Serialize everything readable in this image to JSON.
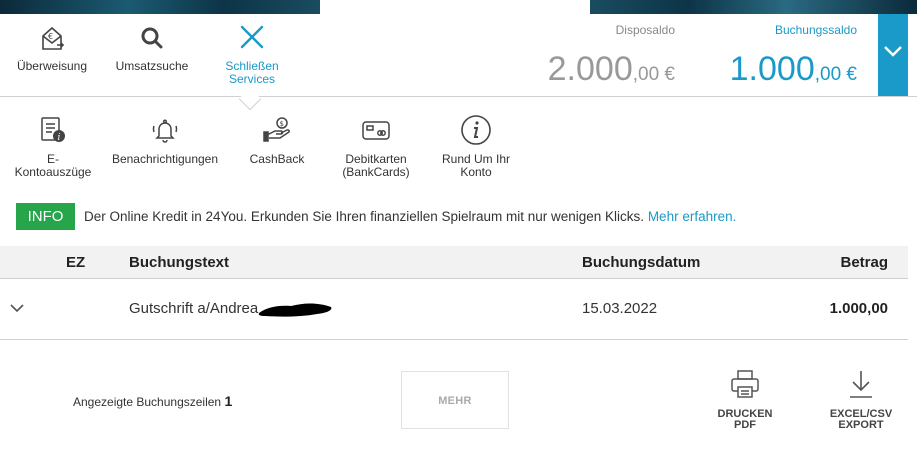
{
  "actions": {
    "ueberweisung": {
      "label": "Überweisung",
      "icon": "transfer-envelope-icon"
    },
    "umsatzsuche": {
      "label": "Umsatzsuche",
      "icon": "search-icon"
    },
    "close_services": {
      "label": "Schließen\nServices",
      "icon": "close-icon"
    }
  },
  "balances": {
    "dispo": {
      "title": "Disposaldo",
      "int": "2.000",
      "dec": ",00 €"
    },
    "buchung": {
      "title": "Buchungssaldo",
      "int": "1.000",
      "dec": ",00 €"
    }
  },
  "services": [
    {
      "label": "E-\nKontoauszüge",
      "icon": "statement-info-icon"
    },
    {
      "label": "Benachrichtigungen",
      "icon": "bell-icon"
    },
    {
      "label": "CashBack",
      "icon": "cashback-hand-coin-icon"
    },
    {
      "label": "Debitkarten\n(BankCards)",
      "icon": "card-icon"
    },
    {
      "label": "Rund Um Ihr\nKonto",
      "icon": "info-circle-icon"
    }
  ],
  "info": {
    "badge": "INFO",
    "text": "Der Online Kredit in 24You. Erkunden Sie Ihren finanziellen Spielraum mit nur wenigen Klicks. ",
    "link": "Mehr erfahren."
  },
  "table": {
    "headers": {
      "ez": "EZ",
      "text": "Buchungstext",
      "date": "Buchungsdatum",
      "amount": "Betrag"
    },
    "rows": [
      {
        "text": "Gutschrift a/Andrea",
        "date": "15.03.2022",
        "amount": "1.000,00"
      }
    ]
  },
  "footer": {
    "count_label": "Angezeigte Buchungszeilen",
    "count_value": "1",
    "more_label": "MEHR",
    "print_label": "DRUCKEN\nPDF",
    "export_label": "EXCEL/CSV\nEXPORT"
  },
  "colors": {
    "accent": "#1a9ac8",
    "info_green": "#27a54a"
  }
}
